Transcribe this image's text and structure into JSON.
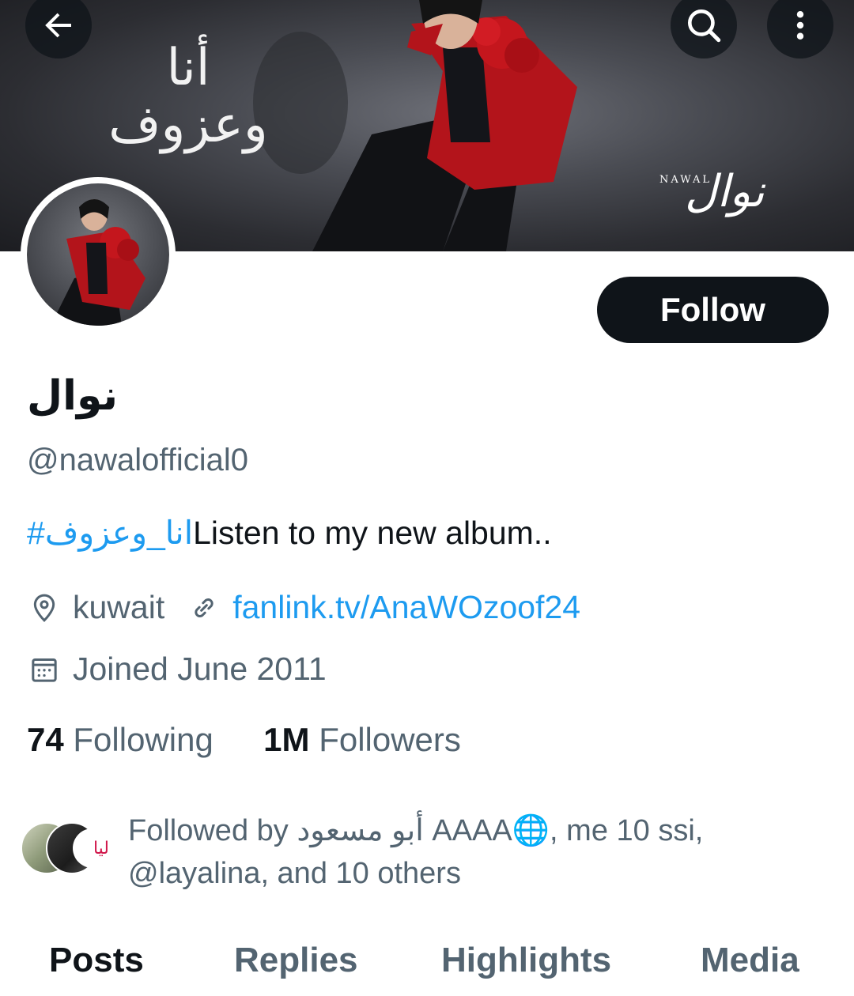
{
  "banner": {
    "arabic_title_line1": "أنا",
    "arabic_title_line2": "وعزوف",
    "logo_small": "NAWAL",
    "logo_script": "نوال"
  },
  "nav": {
    "back_icon": "arrow-left-icon",
    "search_icon": "search-icon",
    "more_icon": "more-vertical-icon"
  },
  "profile": {
    "display_name": "نوال",
    "handle": "@nawalofficial0",
    "bio_hashtag": "#انا_وعزوف",
    "bio_text": "Listen to my new album..",
    "follow_label": "Follow",
    "location": "kuwait",
    "website": "fanlink.tv/AnaWOzoof24",
    "joined": "Joined June 2011"
  },
  "stats": {
    "following_count": "74",
    "following_label": "Following",
    "followers_count": "1M",
    "followers_label": "Followers"
  },
  "followed_by": {
    "line1": "Followed by أبو مسعود AAAA🌐, me 10 ssi,",
    "line2": "@layalina, and 10 others",
    "avatar_c_text": "ليا"
  },
  "tabs": [
    {
      "label": "Posts",
      "active": true
    },
    {
      "label": "Replies",
      "active": false
    },
    {
      "label": "Highlights",
      "active": false
    },
    {
      "label": "Media",
      "active": false
    }
  ],
  "colors": {
    "accent": "#1d9bf0",
    "text_primary": "#0f1419",
    "text_secondary": "#536471",
    "banner_red": "#b3141b"
  }
}
